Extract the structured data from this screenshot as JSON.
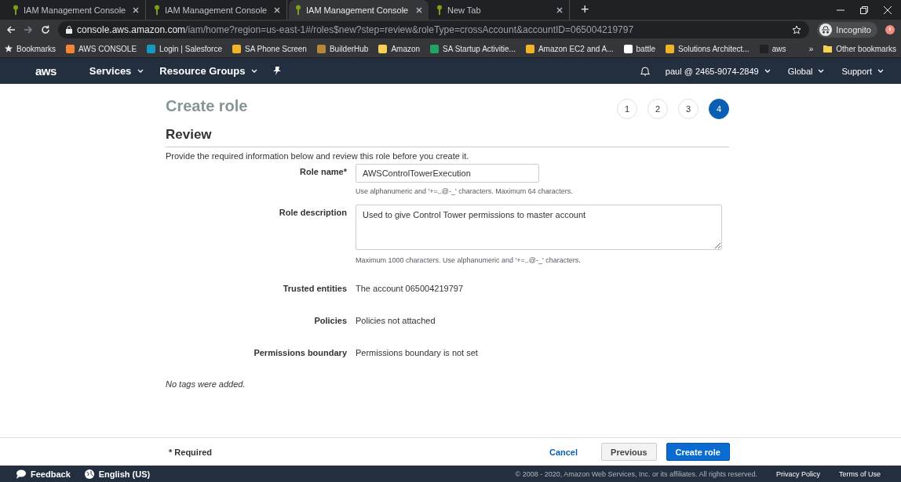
{
  "browser": {
    "tabs": [
      {
        "title": "IAM Management Console",
        "selected": false
      },
      {
        "title": "IAM Management Console",
        "selected": false
      },
      {
        "title": "IAM Management Console",
        "selected": true
      },
      {
        "title": "New Tab",
        "selected": false
      }
    ],
    "new_tab": "+",
    "url_host": "console.aws.amazon.com",
    "url_path": "/iam/home?region=us-east-1#/roles$new?step=review&roleType=crossAccount&accountID=065004219797",
    "profile": "Incognito",
    "bookmarks_label": "Bookmarks",
    "bookmarks": [
      {
        "label": "AWS CONSOLE",
        "color": "#f58536"
      },
      {
        "label": "Login | Salesforce",
        "color": "#1798c1"
      },
      {
        "label": "SA Phone Screen",
        "color": "#f0b429"
      },
      {
        "label": "BuilderHub",
        "color": "#b8863b"
      },
      {
        "label": "Amazon",
        "color": "#f7d154"
      },
      {
        "label": "SA Startup Activitie...",
        "color": "#21a366"
      },
      {
        "label": "Amazon EC2 and A...",
        "color": "#f0b429"
      },
      {
        "label": "battle",
        "color": "#ffffff"
      },
      {
        "label": "Solutions Architect...",
        "color": "#f0b429"
      },
      {
        "label": "aws",
        "color": "#222222"
      }
    ],
    "overflow": "»",
    "other_bookmarks": "Other bookmarks"
  },
  "console_nav": {
    "logo": "aws",
    "services": "Services",
    "resource_groups": "Resource Groups",
    "account": "paul @ 2465-9074-2849",
    "region": "Global",
    "support": "Support"
  },
  "page": {
    "title": "Create role",
    "steps": [
      {
        "label": "1",
        "selected": false
      },
      {
        "label": "2",
        "selected": false
      },
      {
        "label": "3",
        "selected": false
      },
      {
        "label": "4",
        "selected": true
      }
    ],
    "section_title": "Review",
    "intro": "Provide the required information below and review this role before you create it.",
    "role_name": {
      "label": "Role name*",
      "value": "AWSControlTowerExecution",
      "hint": "Use alphanumeric and '+=,.@-_' characters. Maximum 64 characters."
    },
    "role_description": {
      "label": "Role description",
      "value": "Used to give Control Tower permissions to master account",
      "hint": "Maximum 1000 characters. Use alphanumeric and '+=,.@-_' characters."
    },
    "details": [
      {
        "label": "Trusted entities",
        "value": "The account 065004219797"
      },
      {
        "label": "Policies",
        "value": "Policies not attached"
      },
      {
        "label": "Permissions boundary",
        "value": "Permissions boundary is not set"
      }
    ],
    "tags_note": "No tags were added."
  },
  "footer": {
    "required": "* Required",
    "cancel": "Cancel",
    "previous": "Previous",
    "create": "Create role"
  },
  "bottom_bar": {
    "feedback": "Feedback",
    "language": "English (US)",
    "copyright": "© 2008 - 2020, Amazon Web Services, Inc. or its affiliates. All rights reserved.",
    "privacy": "Privacy Policy",
    "terms": "Terms of Use"
  }
}
